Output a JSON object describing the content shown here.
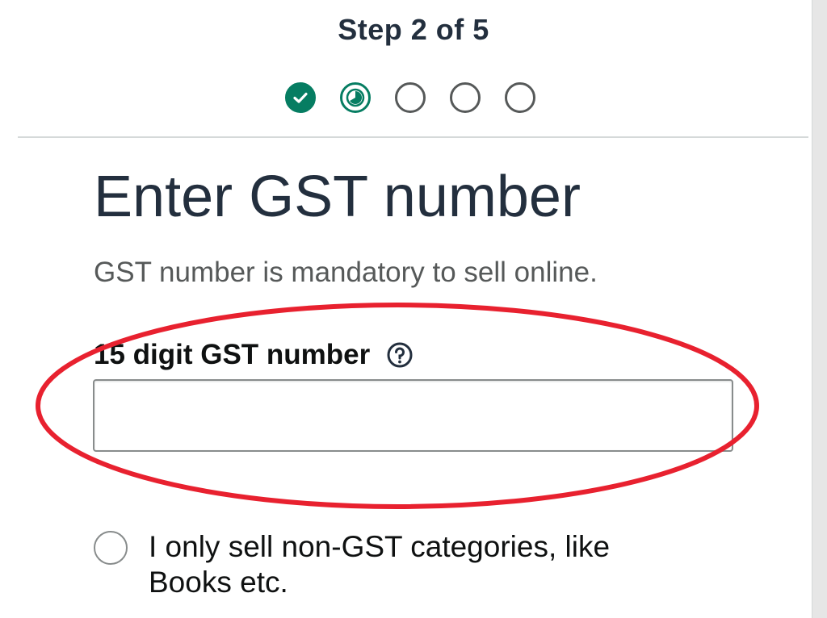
{
  "header": {
    "step_label": "Step 2 of 5",
    "steps": [
      {
        "state": "completed",
        "icon": "check-icon"
      },
      {
        "state": "in-progress",
        "icon": "half-circle-icon"
      },
      {
        "state": "pending"
      },
      {
        "state": "pending"
      },
      {
        "state": "pending"
      }
    ]
  },
  "main": {
    "title": "Enter GST number",
    "subtitle": "GST number is mandatory to sell online.",
    "gst_field": {
      "label": "15 digit GST number",
      "help_icon": "question-circle-icon",
      "value": "",
      "placeholder": ""
    },
    "non_gst_option": {
      "label": "I only sell non-GST categories, like Books etc.",
      "selected": false
    },
    "highlight_color": "#e8212f"
  },
  "colors": {
    "accent_green": "#067d62",
    "heading": "#232f3e",
    "muted_text": "#565959",
    "border": "#888c8c"
  }
}
